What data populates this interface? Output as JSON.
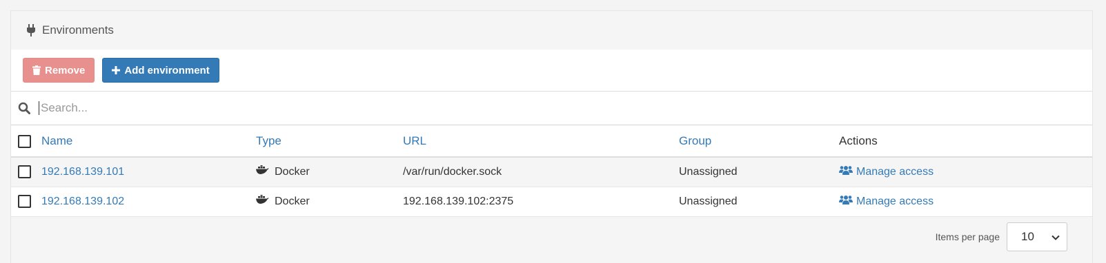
{
  "header": {
    "title": "Environments",
    "icon": "plug-icon"
  },
  "toolbar": {
    "remove_label": "Remove",
    "add_label": "Add environment"
  },
  "search": {
    "placeholder": "Search...",
    "value": ""
  },
  "table": {
    "columns": [
      {
        "label": "Name",
        "sortable": true
      },
      {
        "label": "Type",
        "sortable": true
      },
      {
        "label": "URL",
        "sortable": true
      },
      {
        "label": "Group",
        "sortable": true
      },
      {
        "label": "Actions",
        "sortable": false
      }
    ],
    "rows": [
      {
        "name": "192.168.139.101",
        "type": "Docker",
        "url": "/var/run/docker.sock",
        "group": "Unassigned",
        "action": "Manage access"
      },
      {
        "name": "192.168.139.102",
        "type": "Docker",
        "url": "192.168.139.102:2375",
        "group": "Unassigned",
        "action": "Manage access"
      }
    ]
  },
  "footer": {
    "items_per_page_label": "Items per page",
    "items_per_page_value": "10"
  },
  "colors": {
    "link": "#337ab7",
    "remove_button": "#e8908d",
    "add_button": "#337ab7"
  }
}
